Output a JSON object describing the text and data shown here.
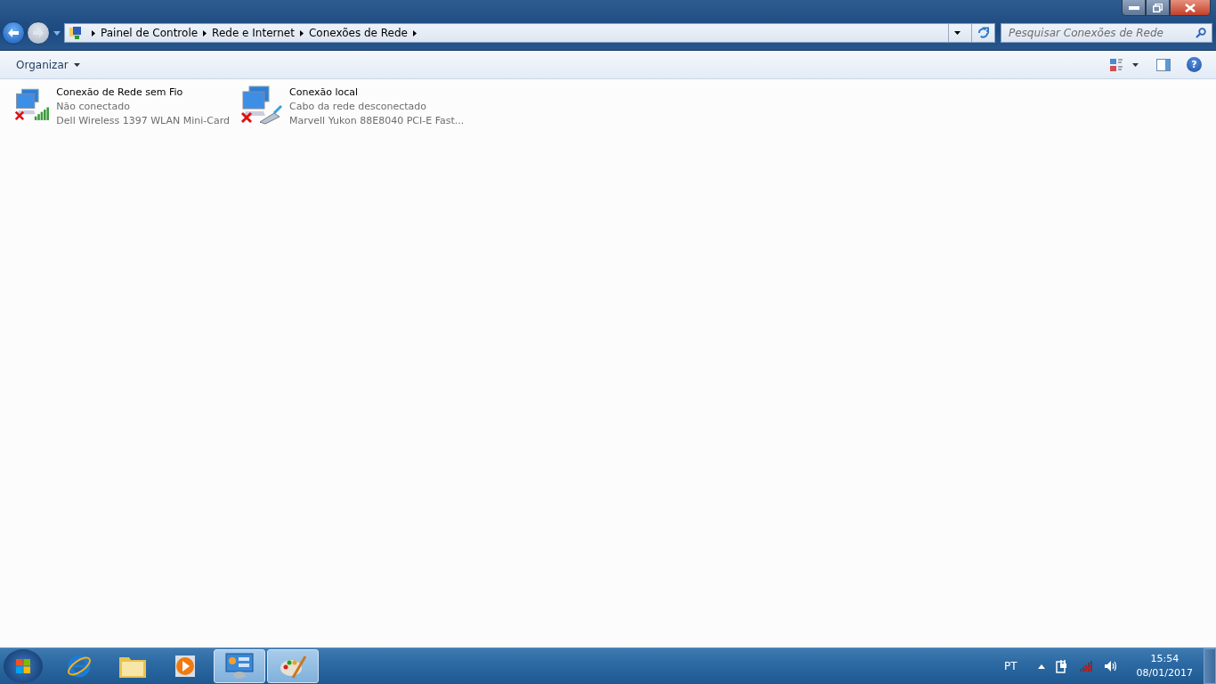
{
  "address_bar": {
    "breadcrumbs": [
      "Painel de Controle",
      "Rede e Internet",
      "Conexões de Rede"
    ]
  },
  "search": {
    "placeholder": "Pesquisar Conexões de Rede"
  },
  "toolbar": {
    "organize": "Organizar",
    "help": "?"
  },
  "connections": [
    {
      "name": "Conexão de Rede sem Fio",
      "status": "Não conectado",
      "adapter": "Dell Wireless 1397 WLAN Mini-Card",
      "kind": "wireless",
      "disconnected": true
    },
    {
      "name": "Conexão local",
      "status": "Cabo da rede desconectado",
      "adapter": "Marvell Yukon 88E8040 PCI-E Fast...",
      "kind": "wired",
      "disconnected": true
    }
  ],
  "taskbar": {
    "apps": [
      {
        "kind": "browser",
        "selected": false
      },
      {
        "kind": "folder",
        "selected": false
      },
      {
        "kind": "media",
        "selected": false
      },
      {
        "kind": "control",
        "selected": true
      },
      {
        "kind": "paint",
        "selected": true
      }
    ],
    "language": "PT",
    "time": "15:54",
    "date": "08/01/2017"
  }
}
